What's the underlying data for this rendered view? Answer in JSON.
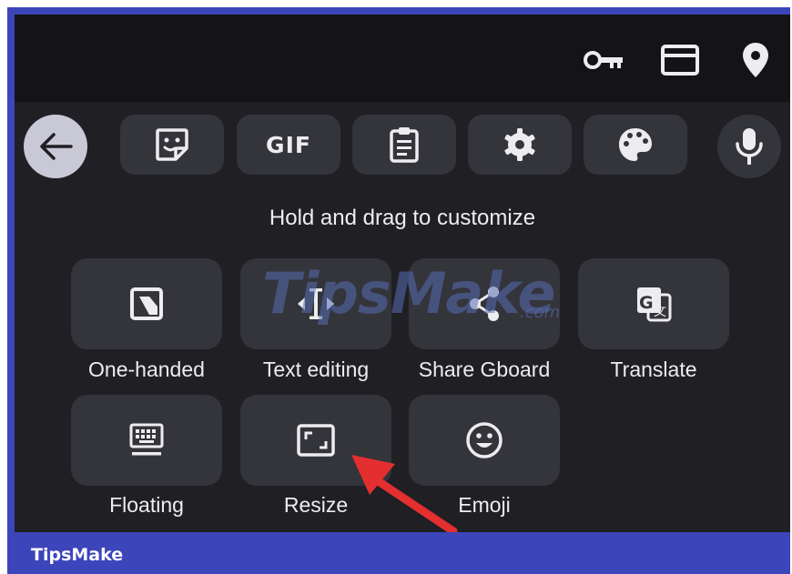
{
  "toolbar": {
    "gif_label": "GIF"
  },
  "instruction": "Hold and drag to customize",
  "tiles": [
    {
      "label": "One-handed",
      "icon": "one-handed-icon"
    },
    {
      "label": "Text editing",
      "icon": "text-cursor-icon"
    },
    {
      "label": "Share Gboard",
      "icon": "share-icon"
    },
    {
      "label": "Translate",
      "icon": "translate-icon"
    },
    {
      "label": "Floating",
      "icon": "keyboard-icon"
    },
    {
      "label": "Resize",
      "icon": "resize-icon"
    },
    {
      "label": "Emoji",
      "icon": "smiley-icon"
    }
  ],
  "watermark": {
    "text": "TipsMake",
    "suffix": ".com"
  },
  "footer": {
    "brand": "TipsMake"
  },
  "colors": {
    "frame": "#3d45bb",
    "screen": "#1f1f24",
    "tile": "#34343b",
    "arrow": "#e32f2f"
  }
}
